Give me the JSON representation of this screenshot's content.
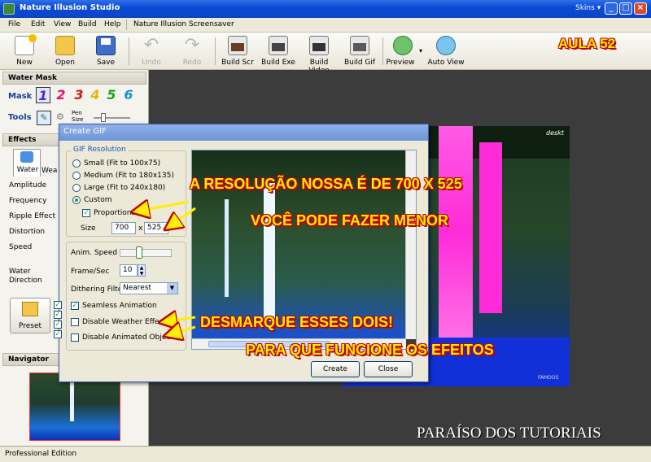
{
  "window": {
    "title": "Nature Illusion Studio",
    "skins_label": "Skins",
    "minimize": "_",
    "maximize": "□",
    "close": "×"
  },
  "menu": [
    "File",
    "Edit",
    "View",
    "Build",
    "Help",
    "Nature Illusion Screensaver"
  ],
  "toolbar": {
    "new": "New",
    "open": "Open",
    "save": "Save",
    "undo": "Undo",
    "redo": "Redo",
    "build_scr": "Build Scr",
    "build_exe": "Build Exe",
    "build_video": "Build Video",
    "build_gif": "Build Gif",
    "preview": "Preview",
    "auto_view": "Auto View"
  },
  "left_panel": {
    "water_mask_title": "Water Mask",
    "mask_label": "Mask",
    "mask_buttons": [
      "1",
      "2",
      "3",
      "4",
      "5",
      "6"
    ],
    "tools_label": "Tools",
    "pen_size_label": "Pen\nSize",
    "effects_title": "Effects",
    "tab_water": "Water",
    "tab_weather": "Wea",
    "params": [
      "Amplitude",
      "Frequency",
      "Ripple Effect",
      "Distortion",
      "Speed",
      "Water\nDirection"
    ],
    "preset_label": "Preset",
    "navigator_title": "Navigator"
  },
  "status_bar": {
    "text": "Professional Edition"
  },
  "dialog": {
    "title": "Create GIF",
    "resolution_group": "GIF Resolution",
    "options": [
      {
        "label": "Small (Fit to 100x75)",
        "selected": false
      },
      {
        "label": "Medium (Fit to 180x135)",
        "selected": false
      },
      {
        "label": "Large (Fit to 240x180)",
        "selected": false
      },
      {
        "label": "Custom",
        "selected": true
      }
    ],
    "proportional_label": "Proportional",
    "proportional_checked": true,
    "size_label": "Size",
    "width": "700",
    "x_label": "x",
    "height": "525",
    "anim_speed_label": "Anim. Speed",
    "frame_sec_label": "Frame/Sec",
    "frame_sec_value": "10",
    "dithering_label": "Dithering Filter",
    "dithering_value": "Nearest",
    "seamless_label": "Seamless Animation",
    "seamless_checked": true,
    "disable_weather_label": "Disable Weather Effect",
    "disable_weather_checked": false,
    "disable_animated_label": "Disable Animated Objects",
    "disable_animated_checked": false,
    "create_button": "Create",
    "close_button": "Close"
  },
  "overlays": {
    "aula": "AULA 52",
    "resolution_note": "A RESOLUÇÃO NOSSA É DE 700 X 525",
    "smaller_note": "VOCÊ PODE FAZER MENOR",
    "uncheck_note": "DESMARQUE ESSES DOIS!",
    "effects_note": "PARA QUE FUNCIONE OS EFEITOS",
    "watermark": "PARAÍSO DOS TUTORIAIS"
  },
  "preview": {
    "logo_text": "deskt",
    "corner_text": "FAMOOS"
  },
  "colors": {
    "title_blue": "#0b4cd6",
    "overlay_yellow": "#ffef00",
    "overlay_red": "#c00000",
    "pink_water": "#ff2bd8"
  }
}
